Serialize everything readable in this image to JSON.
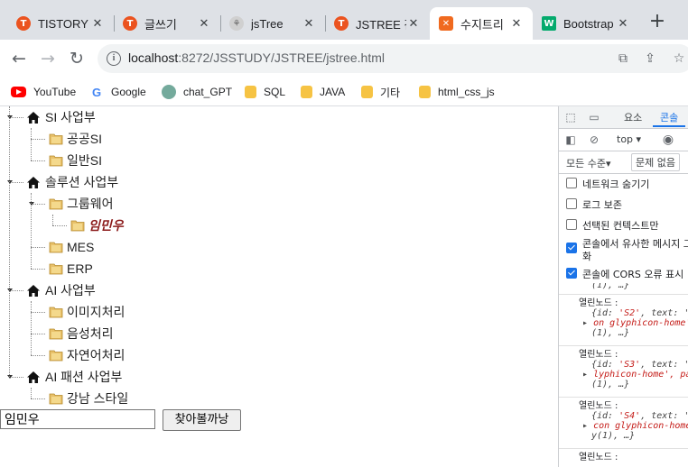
{
  "browser": {
    "tabs": [
      {
        "label": "TISTORY",
        "favicon": "tistory-icon",
        "color": "#eb531f"
      },
      {
        "label": "글쓰기",
        "favicon": "tistory-icon",
        "color": "#eb531f"
      },
      {
        "label": "jsTree",
        "favicon": "tree-icon",
        "color": "#9e9e9e"
      },
      {
        "label": "JSTREE 간",
        "favicon": "tistory-icon",
        "color": "#eb531f"
      },
      {
        "label": "수지트리",
        "favicon": "xampp-icon",
        "color": "#f06a1f",
        "active": true
      },
      {
        "label": "Bootstrap",
        "favicon": "w3-icon",
        "color": "#04aa6d"
      }
    ],
    "new_tab": "+",
    "url_host": "localhost",
    "url_rest": ":8272/JSSTUDY/JSTREE/jstree.html",
    "bookmarks": [
      {
        "label": "YouTube",
        "icon": "youtube-icon"
      },
      {
        "label": "Google",
        "icon": "google-icon"
      },
      {
        "label": "chat_GPT",
        "icon": "chatgpt-icon"
      },
      {
        "label": "SQL",
        "icon": "folder-icon"
      },
      {
        "label": "JAVA",
        "icon": "folder-icon"
      },
      {
        "label": "기타",
        "icon": "folder-icon"
      },
      {
        "label": "html_css_js",
        "icon": "folder-icon"
      }
    ]
  },
  "tree": {
    "nodes": [
      {
        "label": "SI 사업부",
        "type": "home"
      },
      {
        "label": "공공SI",
        "type": "folder"
      },
      {
        "label": "일반SI",
        "type": "folder"
      },
      {
        "label": "솔루션 사업부",
        "type": "home"
      },
      {
        "label": "그룹웨어",
        "type": "folder"
      },
      {
        "label": "임민우",
        "type": "folder",
        "highlight": true
      },
      {
        "label": "MES",
        "type": "folder"
      },
      {
        "label": "ERP",
        "type": "folder"
      },
      {
        "label": "AI 사업부",
        "type": "home"
      },
      {
        "label": "이미지처리",
        "type": "folder"
      },
      {
        "label": "음성처리",
        "type": "folder"
      },
      {
        "label": "자연어처리",
        "type": "folder"
      },
      {
        "label": "AI 패션 사업부",
        "type": "home"
      },
      {
        "label": "강남 스타일",
        "type": "folder"
      }
    ],
    "highlight_color": "#8b1a1a"
  },
  "search": {
    "value": "임민우",
    "button": "찾아볼까낭"
  },
  "devtools": {
    "tabs": {
      "elements": "요소",
      "console": "콘솔"
    },
    "context": "top",
    "levels": "모든 수준",
    "issues": "문제 없음",
    "options": [
      {
        "label": "네트워크 숨기기",
        "checked": false
      },
      {
        "label": "로그 보존",
        "checked": false
      },
      {
        "label": "선택된 컨텍스트만",
        "checked": false
      },
      {
        "label": "콘솔에서 유사한 메시지 그",
        "label2": "화",
        "checked": true
      },
      {
        "label": "콘솔에 CORS 오류 표시",
        "checked": true
      }
    ],
    "logs": [
      {
        "l1": "(1), …}",
        "head": "",
        "l2": "",
        "l3": ""
      },
      {
        "head": "열린노드 :",
        "l1": "{id: ",
        "l1s": "'S2'",
        "l1b": ", text: '",
        "l2": "on glyphicon-home'",
        "l3": "(1), …}"
      },
      {
        "head": "열린노드 :",
        "l1": "{id: ",
        "l1s": "'S3'",
        "l1b": ", text: '",
        "l2": "lyphicon-home', pa",
        "l3": "(1), …}"
      },
      {
        "head": "열린노드 :",
        "l1": "{id: ",
        "l1s": "'S4'",
        "l1b": ", text: '",
        "l2": "con glyphicon-home",
        "l3": "y(1), …}"
      },
      {
        "head": "열린노드 :",
        "l1": "",
        "l1s": "",
        "l1b": "",
        "l2": "",
        "l3": ""
      }
    ]
  }
}
